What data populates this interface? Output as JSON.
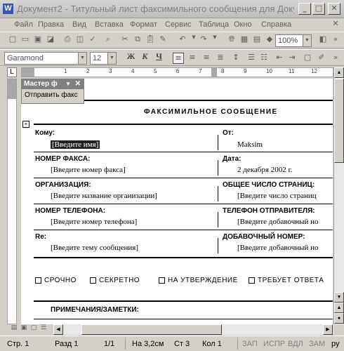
{
  "window": {
    "title": "Документ2 - Титульный лист факсимильного сообщения для Доку...",
    "app_icon": "W",
    "minimize": "_",
    "maximize": "□",
    "close": "✕"
  },
  "menu": [
    "Файл",
    "Правка",
    "Вид",
    "Вставка",
    "Формат",
    "Сервис",
    "Таблица",
    "Окно",
    "Справка"
  ],
  "toolbar": {
    "zoom": "100%"
  },
  "formatting": {
    "font": "Garamond",
    "size": "12",
    "bold": "Ж",
    "italic": "К",
    "underline": "Ч"
  },
  "ruler": {
    "numbers": [
      "1",
      "2",
      "3",
      "4",
      "5",
      "6",
      "7",
      "8",
      "9",
      "10",
      "11",
      "12"
    ]
  },
  "task_pane": {
    "title": "Мастер ф",
    "action": "Отправить факс"
  },
  "fax": {
    "heading": "ФАКСИМИЛЬНОЕ СООБЩЕНИЕ",
    "to_label": "Кому:",
    "to_value": "[Введите имя]",
    "from_label": "От:",
    "from_value": "Maksim",
    "faxnum_label": "НОМЕР ФАКСА:",
    "faxnum_value": "[Введите номер факса]",
    "date_label": "Дата:",
    "date_value": "2 декабря 2002 г.",
    "org_label": "ОРГАНИЗАЦИЯ:",
    "org_value": "[Введите название организации]",
    "pages_label": "ОБЩЕЕ ЧИСЛО СТРАНИЦ:",
    "pages_value": "[Введите число страниц",
    "phone_label": "НОМЕР ТЕЛЕФОНА:",
    "phone_value": "[Введите номер телефона]",
    "sender_phone_label": "ТЕЛЕФОН ОТПРАВИТЕЛЯ:",
    "sender_phone_value": "[Введите добавочный но",
    "re_label": "Re:",
    "re_value": "[Введите тему сообщения]",
    "ext_label": "ДОБАВОЧНЫЙ НОМЕР:",
    "ext_value": "[Введите добавочный но",
    "checkboxes": [
      "СРОЧНО",
      "СЕКРЕТНО",
      "НА УТВЕРЖДЕНИЕ",
      "ТРЕБУЕТ ОТВЕТА"
    ],
    "notes_label": "ПРИМЕЧАНИЯ/ЗАМЕТКИ:"
  },
  "status": {
    "page": "Стр. 1",
    "section": "Разд 1",
    "pages": "1/1",
    "at": "На 3,2см",
    "line": "Ст 3",
    "col": "Кол 1",
    "rec": "ЗАП",
    "trk": "ИСПР",
    "ext": "ВДЛ",
    "ovr": "ЗАМ",
    "lang": "ру"
  }
}
